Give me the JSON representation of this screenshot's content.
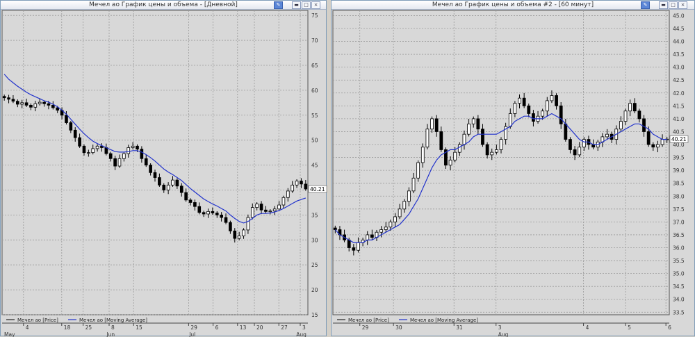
{
  "left": {
    "title": "Мечел ао График цены и объема - [Дневной]",
    "y_ticks": [
      "75",
      "70",
      "65",
      "60",
      "55",
      "50",
      "45",
      "40",
      "35",
      "30",
      "25",
      "20",
      "15"
    ],
    "x_ticks": [
      "4",
      "18",
      "25",
      "8",
      "15",
      "29",
      "6",
      "13",
      "20",
      "27",
      "3"
    ],
    "months": [
      "May",
      "Jun",
      "Jul",
      "Aug"
    ],
    "last_value": "40.21",
    "legend": [
      "Мечел ао [Price]",
      "Мечел ао [Moving Average]"
    ]
  },
  "right": {
    "title": "Мечел ао График цены и объема #2 - [60 минут]",
    "y_ticks": [
      "45.0",
      "44.5",
      "44.0",
      "43.5",
      "43.0",
      "42.5",
      "42.0",
      "41.5",
      "41.0",
      "40.5",
      "40.0",
      "39.5",
      "39.0",
      "38.5",
      "38.0",
      "37.5",
      "37.0",
      "36.5",
      "36.0",
      "35.5",
      "35.0",
      "34.5",
      "34.0",
      "33.5"
    ],
    "x_ticks": [
      "29",
      "30",
      "31",
      "3",
      "4",
      "5",
      "6"
    ],
    "months": [
      "Aug"
    ],
    "last_value": "40.21",
    "legend": [
      "Мечел ао [Price]",
      "Мечел ао [Moving Average]"
    ]
  },
  "colors": {
    "candle": "#000000",
    "ma": "#2233cc",
    "grid": "#9a9a9a",
    "plot_bg": "#d8d8d8"
  },
  "icons": [
    "pin-icon",
    "minimize-icon",
    "maximize-icon",
    "close-icon"
  ],
  "chart_data": [
    {
      "type": "candlestick",
      "series": [
        {
          "name": "Мечел ао [Price]",
          "values": [
            58.5,
            58.2,
            57.8,
            57.2,
            57.5,
            57.0,
            56.6,
            57.3,
            57.6,
            57.3,
            57.0,
            56.5,
            56.0,
            55.0,
            53.5,
            52.0,
            50.5,
            48.8,
            47.5,
            47.5,
            48.3,
            48.8,
            48.5,
            47.3,
            46.3,
            44.8,
            46.3,
            47.3,
            48.5,
            48.8,
            48.2,
            46.3,
            45.0,
            43.5,
            42.5,
            41.0,
            40.0,
            41.0,
            42.0,
            40.8,
            39.5,
            38.0,
            37.5,
            36.7,
            35.5,
            35.2,
            35.7,
            35.4,
            35.0,
            34.5,
            33.5,
            31.8,
            30.3,
            30.8,
            32.0,
            34.5,
            36.5,
            37.2,
            36.0,
            35.7,
            35.8,
            36.2,
            37.0,
            38.5,
            39.8,
            41.0,
            41.8,
            41.2,
            40.21
          ]
        },
        {
          "name": "Мечел ао [Moving Average]",
          "values": [
            63.2,
            62.2,
            61.5,
            60.8,
            60.2,
            59.6,
            59.1,
            58.7,
            58.3,
            57.9,
            57.6,
            57.2,
            56.7,
            56.0,
            55.2,
            54.2,
            53.2,
            52.2,
            51.3,
            50.5,
            49.8,
            49.3,
            48.9,
            48.5,
            48.1,
            47.7,
            47.6,
            47.6,
            47.7,
            47.9,
            47.9,
            47.6,
            47.1,
            46.5,
            45.8,
            45.0,
            44.2,
            43.6,
            43.1,
            42.5,
            41.9,
            41.1,
            40.3,
            39.6,
            38.9,
            38.2,
            37.7,
            37.2,
            36.8,
            36.3,
            35.8,
            35.0,
            34.3,
            33.7,
            33.4,
            33.7,
            34.3,
            35.0,
            35.3,
            35.3,
            35.4,
            35.6,
            35.9,
            36.3,
            36.8,
            37.3,
            37.8,
            38.1,
            38.4
          ]
        }
      ],
      "ylim": [
        15,
        76
      ],
      "y_ticks": [
        75,
        70,
        65,
        60,
        55,
        50,
        45,
        40,
        35,
        30,
        25,
        20,
        15
      ],
      "x_ticks": [
        "4",
        "18",
        "25",
        "8",
        "15",
        "29",
        "6",
        "13",
        "20",
        "27",
        "3"
      ],
      "months": [
        "May",
        "Jun",
        "Jul",
        "Aug"
      ],
      "grid": true,
      "legend": "bottom-left"
    },
    {
      "type": "candlestick",
      "series": [
        {
          "name": "Мечел ао [Price]",
          "values": [
            36.7,
            36.5,
            36.3,
            36.0,
            35.9,
            36.2,
            36.3,
            36.5,
            36.4,
            36.6,
            36.7,
            36.8,
            37.0,
            37.2,
            37.5,
            37.8,
            38.2,
            38.7,
            39.3,
            39.9,
            40.6,
            41.0,
            40.5,
            39.8,
            39.2,
            39.4,
            39.7,
            40.0,
            40.4,
            40.8,
            41.0,
            40.6,
            40.0,
            39.6,
            39.7,
            39.8,
            40.2,
            40.7,
            41.2,
            41.6,
            41.8,
            41.5,
            41.2,
            40.9,
            41.1,
            41.3,
            41.7,
            41.9,
            41.5,
            40.8,
            40.2,
            39.8,
            39.6,
            39.9,
            40.2,
            40.0,
            39.9,
            40.1,
            40.3,
            40.4,
            40.2,
            40.6,
            40.9,
            41.3,
            41.6,
            41.3,
            41.0,
            40.5,
            40.0,
            39.9,
            40.0,
            40.2,
            40.21
          ]
        },
        {
          "name": "Мечел ао [Moving Average]",
          "values": [
            36.7,
            36.5,
            36.4,
            36.3,
            36.2,
            36.2,
            36.2,
            36.3,
            36.3,
            36.4,
            36.5,
            36.6,
            36.7,
            36.8,
            36.9,
            37.1,
            37.3,
            37.6,
            37.9,
            38.3,
            38.7,
            39.1,
            39.4,
            39.6,
            39.7,
            39.8,
            39.8,
            39.9,
            40.0,
            40.1,
            40.3,
            40.4,
            40.4,
            40.4,
            40.4,
            40.4,
            40.5,
            40.6,
            40.7,
            40.9,
            41.0,
            41.1,
            41.1,
            41.0,
            41.0,
            41.0,
            41.1,
            41.2,
            41.1,
            41.0,
            40.8,
            40.6,
            40.4,
            40.2,
            40.1,
            40.1,
            40.0,
            40.0,
            40.1,
            40.2,
            40.3,
            40.4,
            40.5,
            40.6,
            40.7,
            40.8,
            40.8,
            40.7,
            40.6,
            40.4,
            40.3,
            40.2,
            40.2
          ]
        }
      ],
      "ylim": [
        33.4,
        45.2
      ],
      "y_ticks": [
        45.0,
        44.5,
        44.0,
        43.5,
        43.0,
        42.5,
        42.0,
        41.5,
        41.0,
        40.5,
        40.0,
        39.5,
        39.0,
        38.5,
        38.0,
        37.5,
        37.0,
        36.5,
        36.0,
        35.5,
        35.0,
        34.5,
        34.0,
        33.5
      ],
      "x_ticks": [
        "29",
        "30",
        "31",
        "3",
        "4",
        "5",
        "6"
      ],
      "months": [
        "Aug"
      ],
      "grid": true,
      "legend": "bottom-left"
    }
  ]
}
